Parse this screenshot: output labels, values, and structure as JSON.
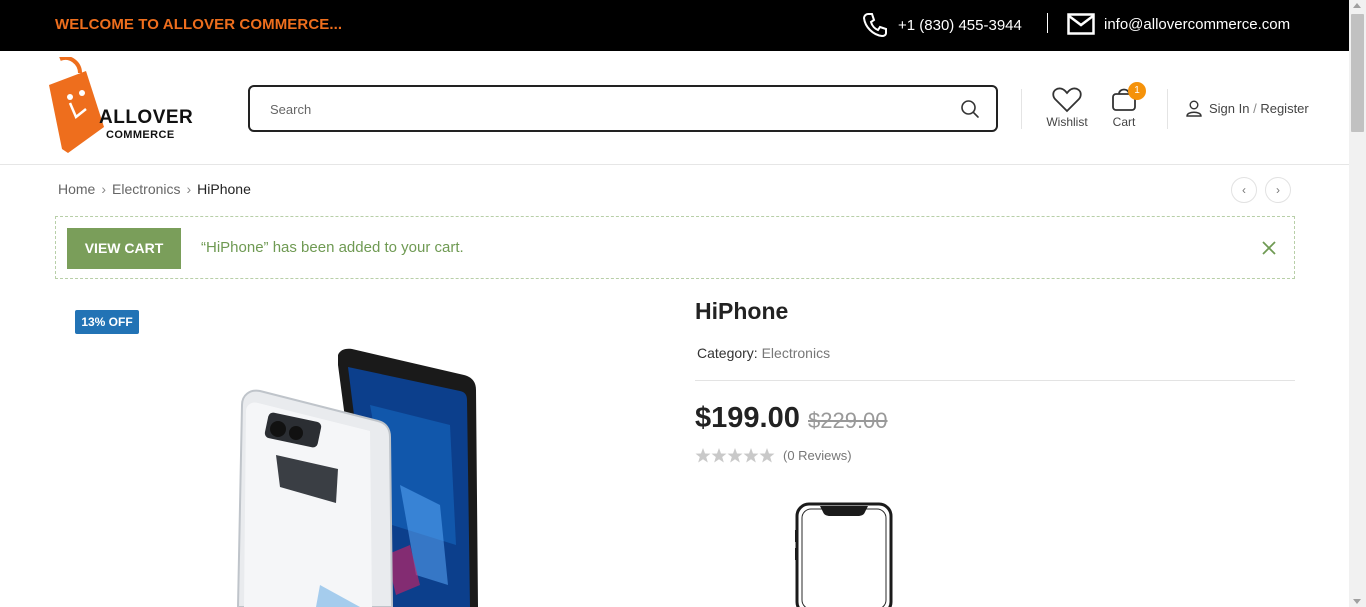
{
  "topbar": {
    "welcome": "WELCOME TO ALLOVER COMMERCE...",
    "phone": "+1 (830) 455-3944",
    "email": "info@allovercommerce.com"
  },
  "header": {
    "logo_line1": "ALLOVER",
    "logo_line2": "COMMERCE",
    "search_placeholder": "Search",
    "wishlist_label": "Wishlist",
    "cart_label": "Cart",
    "cart_count": "1",
    "signin_label": "Sign In",
    "register_sep": " / ",
    "register_label": "Register"
  },
  "breadcrumb": {
    "items": [
      "Home",
      "Electronics",
      "HiPhone"
    ]
  },
  "notice": {
    "button": "VIEW CART",
    "message": "“HiPhone” has been added to your cart."
  },
  "product": {
    "badge": "13% OFF",
    "title": "HiPhone",
    "category_label": "Category:",
    "category": "Electronics",
    "price": "$199.00",
    "old_price": "$229.00",
    "rating": 0,
    "reviews": "(0 Reviews)"
  },
  "colors": {
    "accent_orange": "#ee6e1d",
    "notice_green": "#7a9e5a",
    "badge_blue": "#2273b5",
    "cart_badge": "#f5920a"
  }
}
